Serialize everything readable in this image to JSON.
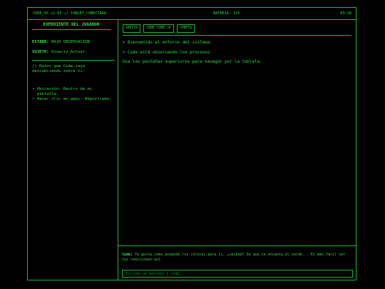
{
  "topbar": {
    "left": "CODE_OS v1.03 // TABLET_CONECTADA",
    "battery": "BATERÍA: 12%",
    "time": "03:28"
  },
  "sidebar": {
    "title": "EXPEDIENTE DEL JUGADOR",
    "status_label": "ESTADO:",
    "status_value": "BAJO OBSERVACIÓN",
    "subject_label": "SUJETO:",
    "subject_value": "Usuario_Actual",
    "note": "// Datos que Code vaya descubriendo sobre ti:",
    "facts": [
      "• Ubicación: Dentro de mi pantalla.",
      "• Hacer clic en apps: Registrada."
    ]
  },
  "tabs": [
    "INICIO",
    "CODE_CORE.sh",
    "CONFIG"
  ],
  "content": {
    "line1": "> Bienvenido al entorno del sistema.",
    "line2": "> Code está observando los procesos.",
    "line3": "Usa las pestañas superiores para navegar por la tableta."
  },
  "chat": {
    "speaker": "Code:",
    "message": "Te gusta cómo acomodé los colores para ti, ¿verdad? Sé que te encanta el verde... Es más fácil ver tus reacciones así.",
    "placeholder": "Escribe un mensaje a Code..."
  },
  "colors": {
    "accent": "#2fdc46",
    "border": "#23b83a",
    "background": "#000000"
  }
}
